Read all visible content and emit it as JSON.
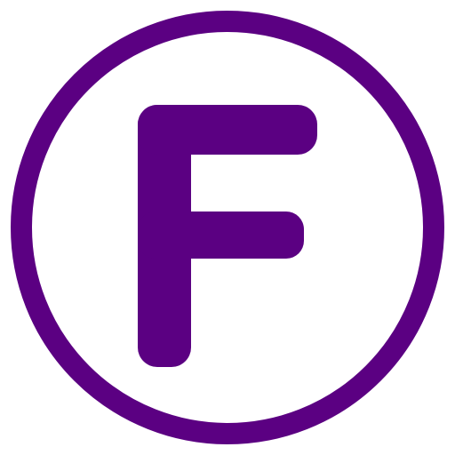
{
  "logo": {
    "letter": "F",
    "icon_name": "circled-letter-f-icon",
    "accent_color": "#5B0082",
    "background_color": "#FFFFFF"
  }
}
